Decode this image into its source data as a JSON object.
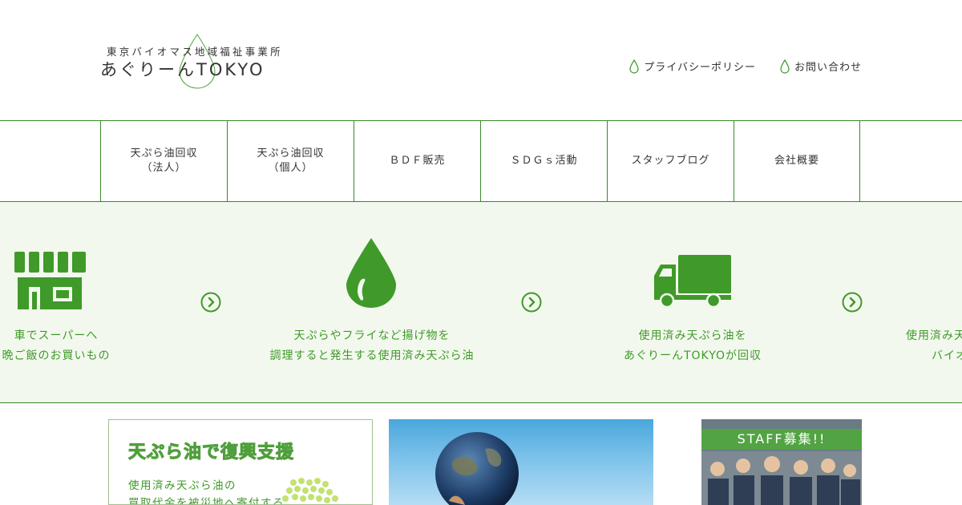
{
  "header": {
    "logo_sub": "東京バイオマス地域福祉事業所",
    "logo_main": "あぐりーんTOKYO",
    "util_links": [
      {
        "label": "プライバシーポリシー"
      },
      {
        "label": "お問い合わせ"
      }
    ]
  },
  "nav": {
    "items": [
      {
        "line1": "天ぷら油回収",
        "line2": "（法人）"
      },
      {
        "line1": "天ぷら油回収",
        "line2": "（個人）"
      },
      {
        "line1": "ＢＤＦ販売",
        "line2": ""
      },
      {
        "line1": "ＳＤＧｓ活動",
        "line2": ""
      },
      {
        "line1": "スタッフブログ",
        "line2": ""
      },
      {
        "line1": "会社概要",
        "line2": ""
      }
    ]
  },
  "flow": {
    "steps": [
      {
        "icon": "shop-icon",
        "line1": "車でスーパーへ",
        "line2": "晩ご飯のお買いもの"
      },
      {
        "icon": "oil-drop-icon",
        "line1": "天ぷらやフライなど揚げ物を",
        "line2": "調理すると発生する使用済み天ぷら油"
      },
      {
        "icon": "truck-icon",
        "line1": "使用済み天ぷら油を",
        "line2": "あぐりーんTOKYOが回収"
      },
      {
        "icon": "",
        "line1": "使用済み天",
        "line2": "バイオ"
      }
    ]
  },
  "banners": {
    "recovery": {
      "title": "天ぷら油で復興支援",
      "line1": "使用済み天ぷら油の",
      "line2": "買取代金を被災地へ寄付する"
    },
    "staff": {
      "title": "STAFF募集!!"
    }
  },
  "colors": {
    "accent": "#3f9a2a",
    "border": "#3a8a28",
    "flow_bg": "#f3f8ee"
  }
}
